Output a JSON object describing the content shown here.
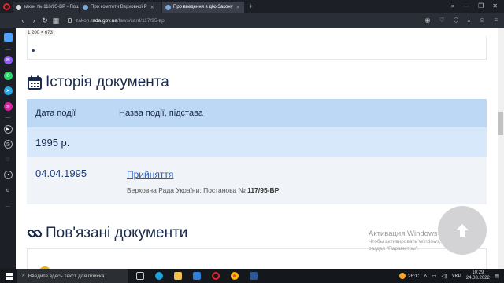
{
  "browser": {
    "tabs": [
      {
        "label": "закон № 116/95-ВР - Пош",
        "active": false
      },
      {
        "label": "Про комітети Верховної Р",
        "active": false
      },
      {
        "label": "Про введення в дію Закону",
        "active": true
      }
    ],
    "url_prefix": "zakon.",
    "url_domain": "rada.gov.ua",
    "url_path": "/laws/card/117/95-вр",
    "viewport_badge": "1 200 × 673"
  },
  "page": {
    "history_title": "Історія документа",
    "table_header": {
      "col1": "Дата події",
      "col2": "Назва події, підстава"
    },
    "year": "1995 р.",
    "event": {
      "date": "04.04.1995",
      "name": "Прийняття",
      "source_prefix": "Верховна Рада України; Постанова №",
      "source_number": "117/95-ВР"
    },
    "linked_title": "Пов'язані документи"
  },
  "watermark": {
    "line1": "Активация Windows",
    "line2": "Чтобы активировать Windows, перейдите в",
    "line3": "раздел \"Параметры\"."
  },
  "taskbar": {
    "search_placeholder": "Введите здесь текст для поиска",
    "weather": "26°C",
    "lang": "УКР",
    "time": "10:29",
    "date": "24.08.2022"
  },
  "colors": {
    "header_bg": "#bcd8f5",
    "year_bg": "#d6e8fa",
    "row_bg": "#f0f4f8",
    "link": "#2a5bb8",
    "title": "#1a2a4a"
  }
}
